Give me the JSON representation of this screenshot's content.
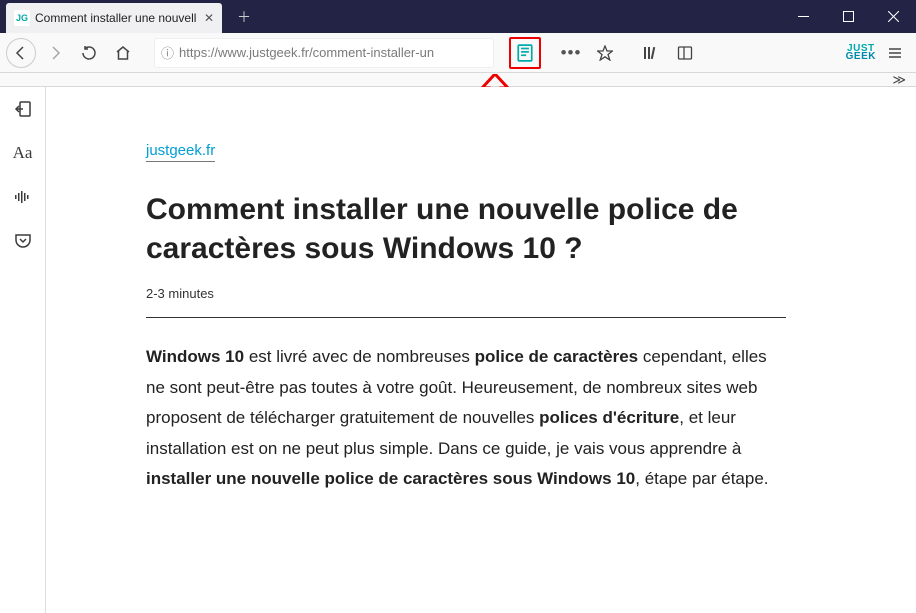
{
  "tab": {
    "title": "Comment installer une nouvell",
    "favicon": "JG"
  },
  "url": "https://www.justgeek.fr/comment-installer-un",
  "brand": {
    "l1": "JUST",
    "l2": "GEEK"
  },
  "article": {
    "domain": "justgeek.fr",
    "title": "Comment installer une nouvelle police de caractères sous Windows 10 ?",
    "readtime": "2-3 minutes",
    "p1a": "Windows 10",
    "p1b": " est livré avec de nombreuses ",
    "p1c": "police de caractères",
    "p1d": " cependant, elles ne sont peut-être pas toutes à votre goût. Heureusement, de nombreux sites web proposent de télécharger gratuitement de nouvelles ",
    "p1e": "polices d'écriture",
    "p1f": ", et leur installation est on ne peut plus simple. Dans ce guide, je vais vous apprendre à ",
    "p1g": "installer une nouvelle police de caractères sous Windows 10",
    "p1h": ", étape par étape."
  }
}
